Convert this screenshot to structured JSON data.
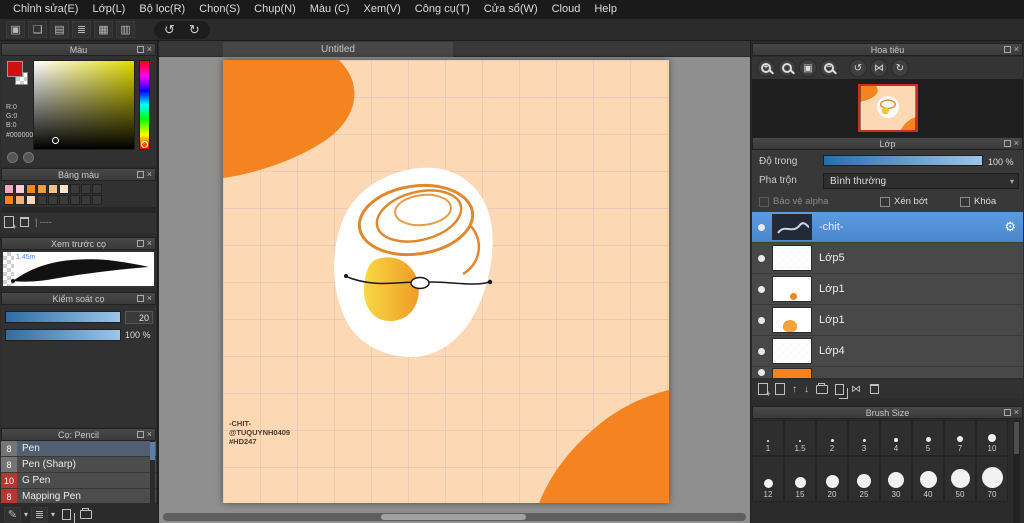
{
  "menubar": {
    "items": [
      "Chỉnh sửa(E)",
      "Lớp(L)",
      "Bộ lọc(R)",
      "Chọn(S)",
      "Chụp(N)",
      "Màu (C)",
      "Xem(V)",
      "Công cụ(T)",
      "Cửa sổ(W)",
      "Cloud",
      "Help"
    ]
  },
  "icons": {
    "close": "×",
    "gear": "⚙",
    "caret": "▾",
    "undo": "↺",
    "redo": "↻",
    "rot_ccw": "↺",
    "rot_cw": "↻",
    "flip": "⋈",
    "up": "↑",
    "down": "↓",
    "pencil": "✎",
    "lines": "≣",
    "grid": "▦",
    "chat": "❑",
    "box": "▣",
    "table": "▥",
    "page": "▤"
  },
  "color_panel": {
    "title": "Màu",
    "r": "R:0",
    "g": "G:0",
    "b": "B:0",
    "hex": "#000000"
  },
  "palette_panel": {
    "title": "Bảng màu",
    "footer": "| ----",
    "row1": [
      "#f2a9bc",
      "#f8ccd6",
      "#f5831f",
      "#f49a3e",
      "#f9c08a",
      "#fde3c8"
    ],
    "row2": [
      "#f5831f",
      "#f2b076",
      "#f7d8ba"
    ]
  },
  "preview_panel": {
    "title": "Xem trước cọ",
    "size": "1.45m"
  },
  "control_panel": {
    "title": "Kiểm soát cọ",
    "value1": "20",
    "value2": "100 %"
  },
  "brushes_panel": {
    "title": "Cọ: Pencil",
    "items": [
      {
        "size": "8",
        "name": "Pen"
      },
      {
        "size": "8",
        "name": "Pen (Sharp)"
      },
      {
        "size": "10",
        "name": "G Pen"
      },
      {
        "size": "8",
        "name": "Mapping Pen"
      }
    ]
  },
  "canvas": {
    "tab": "Untitled",
    "watermark1": "-CHIT-",
    "watermark2": "@TUQUYNH0409",
    "watermark3": "#HD247"
  },
  "navigator": {
    "title": "Hoa tiêu"
  },
  "layers_panel": {
    "title": "Lớp",
    "opacity_label": "Độ trong",
    "opacity_value": "100 %",
    "blend_label": "Pha trộn",
    "blend_value": "Bình thường",
    "cb1": "Bảo vệ alpha",
    "cb2": "Xén bớt",
    "cb3": "Khóa",
    "items": [
      {
        "name": "-chit-"
      },
      {
        "name": "Lớp5"
      },
      {
        "name": "Lớp1"
      },
      {
        "name": "Lớp1"
      },
      {
        "name": "Lớp4"
      }
    ]
  },
  "brush_size_panel": {
    "title": "Brush Size",
    "row1": [
      "1",
      "1.5",
      "2",
      "3",
      "4",
      "5",
      "7",
      "10"
    ],
    "row2": [
      "12",
      "15",
      "20",
      "25",
      "30",
      "40",
      "50",
      "70"
    ]
  },
  "colors": {
    "accent": "#4d8ed6",
    "orange": "#f5831f",
    "peach": "#fcd8b5",
    "selection_red": "#cf2d24",
    "foreground": "#cc1111"
  }
}
